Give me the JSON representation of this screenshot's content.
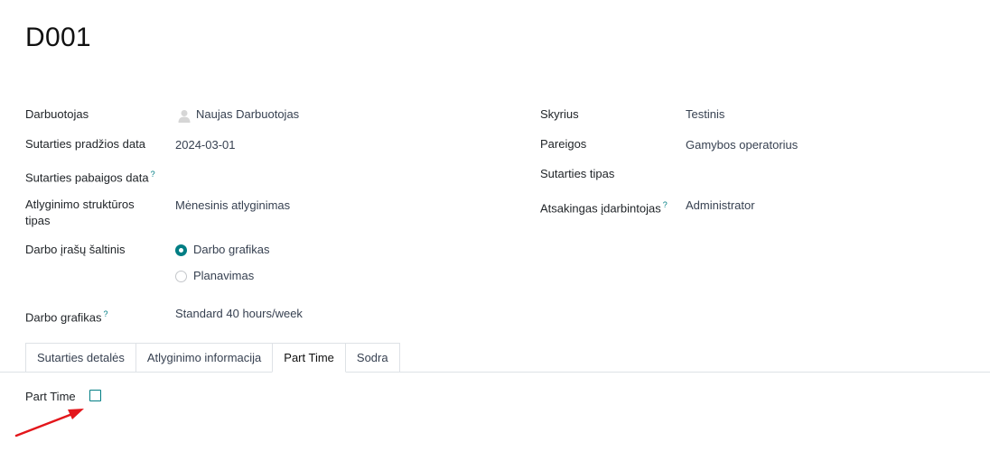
{
  "record": {
    "title": "D001"
  },
  "fields_left": {
    "employee": {
      "label": "Darbuotojas",
      "value": "Naujas Darbuotojas"
    },
    "start_date": {
      "label": "Sutarties pradžios data",
      "value": "2024-03-01"
    },
    "end_date": {
      "label": "Sutarties pabaigos data",
      "help": "?",
      "value": ""
    },
    "salary_structure": {
      "label_line1": "Atlyginimo struktūros",
      "label_line2": "tipas",
      "value": "Mėnesinis atlyginimas"
    },
    "work_entry_source": {
      "label": "Darbo įrašų šaltinis",
      "options": [
        {
          "label": "Darbo grafikas",
          "selected": true
        },
        {
          "label": "Planavimas",
          "selected": false
        }
      ]
    },
    "working_schedule": {
      "label": "Darbo grafikas",
      "help": "?",
      "value": "Standard 40 hours/week"
    }
  },
  "fields_right": {
    "department": {
      "label": "Skyrius",
      "value": "Testinis"
    },
    "job_position": {
      "label": "Pareigos",
      "value": "Gamybos operatorius"
    },
    "contract_type": {
      "label": "Sutarties tipas",
      "value": ""
    },
    "hr_responsible": {
      "label": "Atsakingas įdarbintojas",
      "help": "?",
      "value": "Administrator"
    }
  },
  "tabs": [
    {
      "label": "Sutarties detalės",
      "active": false
    },
    {
      "label": "Atlyginimo informacija",
      "active": false
    },
    {
      "label": "Part Time",
      "active": true
    },
    {
      "label": "Sodra",
      "active": false
    }
  ],
  "part_time": {
    "label": "Part Time",
    "checked": false
  },
  "colors": {
    "accent": "#017e84",
    "annotation_arrow": "#e3161b"
  }
}
